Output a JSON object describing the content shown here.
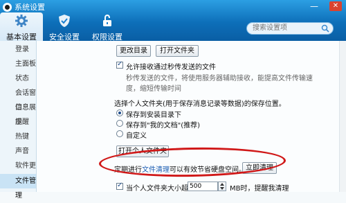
{
  "window": {
    "title": "系统设置",
    "minimize": "—",
    "close": "✕"
  },
  "toptabs": [
    {
      "label": "基本设置",
      "icon": "gear-icon"
    },
    {
      "label": "安全设置",
      "icon": "shield-icon"
    },
    {
      "label": "权限设置",
      "icon": "lock-icon"
    }
  ],
  "search": {
    "placeholder": "搜索设置项"
  },
  "sidebar": {
    "items": [
      {
        "label": "登录"
      },
      {
        "label": "主面板"
      },
      {
        "label": "状态"
      },
      {
        "label": "会话窗口"
      },
      {
        "label": "信息展示"
      },
      {
        "label": "提醒"
      },
      {
        "label": "热键"
      },
      {
        "label": "声音"
      },
      {
        "label": "软件更新"
      },
      {
        "label": "文件管理"
      }
    ],
    "active_index": 9
  },
  "content": {
    "change_dir_button": "更改目录",
    "open_folder_button": "打开文件夹",
    "allow_offline": {
      "label": "允许接收通过秒传发送的文件",
      "checked": true,
      "desc_line1": "秒传发送的文件，将使用服务器辅助接收，能提高文件传输速",
      "desc_line2": "度，缩短传输时间"
    },
    "save_location_prompt": "选择个人文件夹(用于保存消息记录等数据)的保存位置。",
    "save_options": [
      {
        "label": "保存到安装目录下",
        "selected": true
      },
      {
        "label": "保存到\"我的文档\"(推荐)",
        "selected": false
      },
      {
        "label": "自定义",
        "selected": false
      }
    ],
    "personal_folder_button": "打开个人文件夹",
    "cleanup_text_before": "定期进行",
    "cleanup_link": "文件清理",
    "cleanup_text_after": "可以有效节省硬盘空间。",
    "cleanup_button": "立即清理",
    "size_limit": {
      "label_before": "当个人文件夹大小超过",
      "value": "500",
      "label_after": "MB时，提醒我清理",
      "checked": true
    }
  }
}
